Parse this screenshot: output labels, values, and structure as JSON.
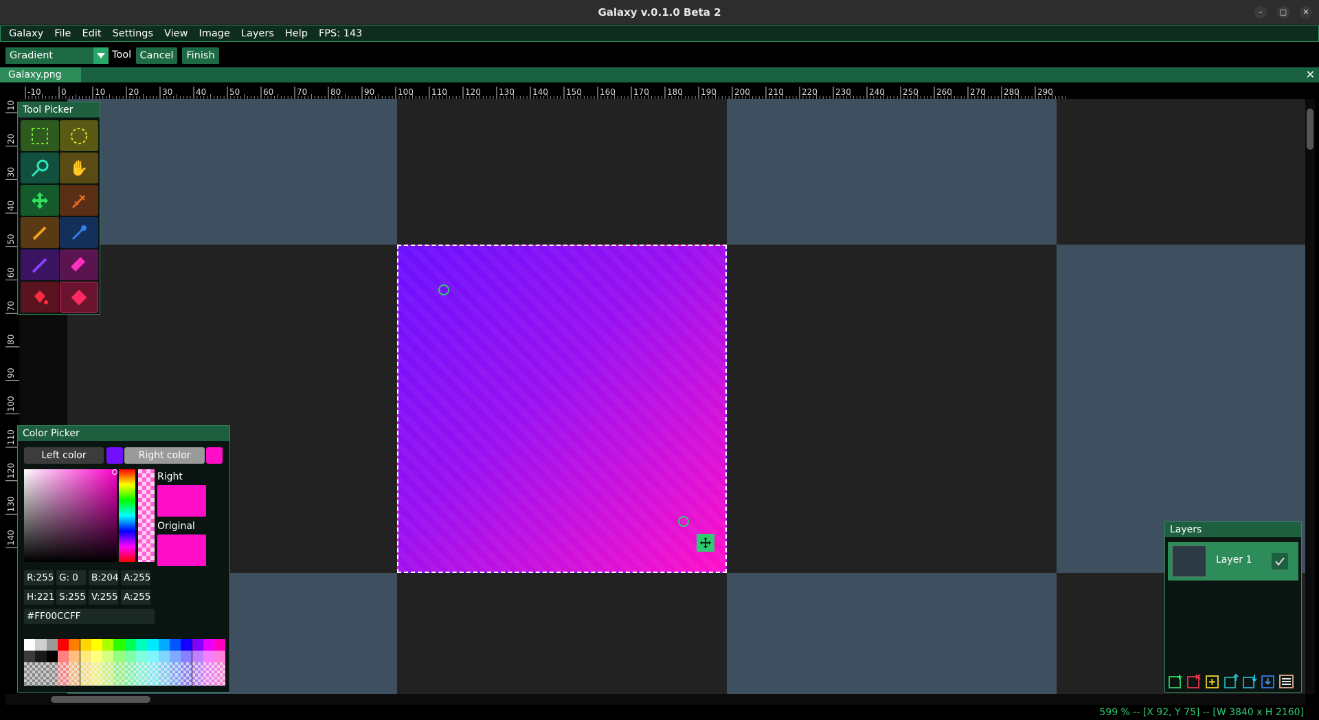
{
  "window": {
    "title": "Galaxy v.0.1.0 Beta 2"
  },
  "menu": [
    "Galaxy",
    "File",
    "Edit",
    "Settings",
    "View",
    "Image",
    "Layers",
    "Help"
  ],
  "fps": "FPS: 143",
  "toolbar": {
    "tool_select": "Gradient",
    "tool_label": "Tool",
    "cancel": "Cancel",
    "finish": "Finish"
  },
  "tab": {
    "name": "Galaxy.png"
  },
  "ruler": {
    "h_labels": [
      "-10",
      "0",
      "10",
      "20",
      "30",
      "40",
      "50",
      "60",
      "70",
      "80",
      "90",
      "100",
      "110",
      "120",
      "130",
      "140",
      "150",
      "160",
      "170",
      "180",
      "190",
      "200",
      "210",
      "220",
      "230",
      "240",
      "250",
      "260",
      "270",
      "280",
      "290"
    ],
    "v_labels": [
      "10",
      "20",
      "30",
      "40",
      "50",
      "60",
      "70",
      "80",
      "90",
      "100",
      "110",
      "120",
      "130",
      "140"
    ]
  },
  "tool_picker": {
    "title": "Tool Picker",
    "tools": [
      "rect-select",
      "ellipse-select",
      "magic-wand",
      "hand",
      "move",
      "wand-tool",
      "pencil",
      "color-picker",
      "brush",
      "eraser",
      "fill-bucket",
      "gradient"
    ],
    "active": "gradient"
  },
  "color_picker": {
    "title": "Color Picker",
    "left_label": "Left color",
    "right_label": "Right color",
    "left_color": "#7010FF",
    "right_color": "#FF00CC",
    "right_caption": "Right",
    "original_caption": "Original",
    "rgba": [
      "R:255",
      "G:  0",
      "B:204",
      "A:255"
    ],
    "hsva": [
      "H:221",
      "S:255",
      "V:255",
      "A:255"
    ],
    "hex": "#FF00CCFF"
  },
  "layers": {
    "title": "Layers",
    "items": [
      {
        "name": "Layer 1",
        "visible": true
      }
    ]
  },
  "status": "599 % -- [X 92, Y 75] -- [W 3840 x H 2160]",
  "colors": {
    "accent": "#2e8b5a",
    "panel_header": "#1e5f40",
    "gradient_start": "#6a10ff",
    "gradient_end": "#ff10c8"
  }
}
